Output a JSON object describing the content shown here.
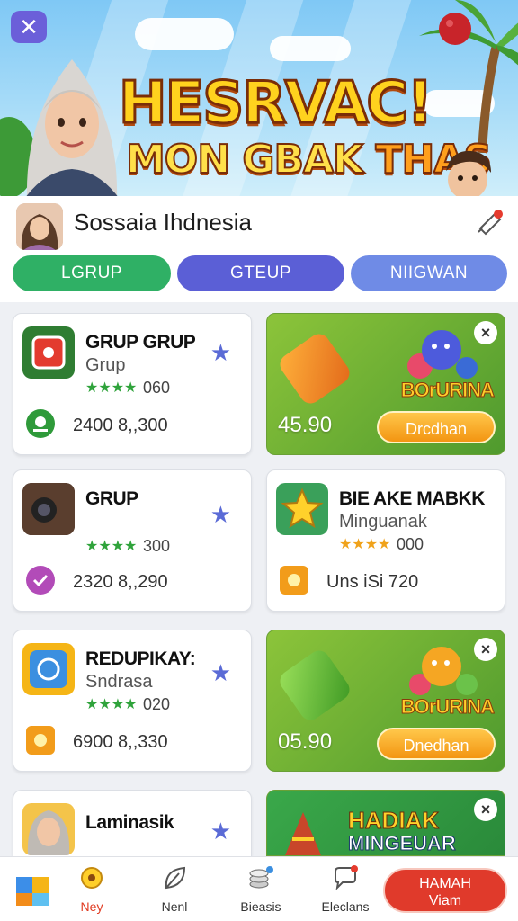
{
  "banner": {
    "close_icon": "x-icon",
    "title_line1": "HESRVAC!",
    "title_line2_a": "MON GBAK ",
    "title_line2_b": "THAS"
  },
  "header": {
    "title": "Sossaia Ihdnesia",
    "notification_icon": "bell-icon"
  },
  "tabs": [
    {
      "label": "LGRUP",
      "color": "#2fb065"
    },
    {
      "label": "GTEUP",
      "color": "#5b5fd6"
    },
    {
      "label": "NIIGWAN",
      "color": "#6f8be6"
    }
  ],
  "cards": [
    {
      "title": "GRUP GRUP",
      "subtitle": "Grup",
      "stars": "★★★★",
      "count": "060",
      "footer": "2400 8,,300",
      "icon": "red-square-icon",
      "fav_icon": "star-icon"
    },
    {
      "title": "GRUP",
      "subtitle": "",
      "stars": "★★★★",
      "count": "300",
      "footer": "2320 8,,290",
      "icon": "camera-icon",
      "fav_icon": "star-icon"
    },
    {
      "title": "BIE AKE MABKK",
      "subtitle": "Minguanak",
      "stars": "★★★★",
      "count": "000",
      "footer": "Uns iSi 720",
      "icon": "star-icon",
      "fav_icon": ""
    },
    {
      "title": "REDUPIKAY:",
      "subtitle": "Sndrasa",
      "stars": "★★★★",
      "count": "020",
      "footer": "6900 8,,330",
      "icon": "app-icon",
      "fav_icon": "star-icon"
    },
    {
      "title": "Laminasik",
      "subtitle": "",
      "stars": "",
      "count": "",
      "footer": "",
      "icon": "avatar-icon",
      "fav_icon": "star-icon"
    }
  ],
  "ads": [
    {
      "brand": "BOrURINA",
      "price": "45.90",
      "button": "Drcdhan"
    },
    {
      "brand": "BOrURINA",
      "price": "05.90",
      "button": "Dnedhan"
    },
    {
      "brand_line1": "HADIAK",
      "brand_line2": "MINGEUAR"
    }
  ],
  "bottom_nav": {
    "items": [
      {
        "label": "",
        "icon": "cube-icon"
      },
      {
        "label": "Ney",
        "icon": "flower-icon"
      },
      {
        "label": "Nenl",
        "icon": "leaf-icon"
      },
      {
        "label": "Bieasis",
        "icon": "coins-icon"
      },
      {
        "label": "Eleclans",
        "icon": "chat-icon"
      }
    ],
    "cta_line1": "HAMAH",
    "cta_line2": "Viam"
  }
}
